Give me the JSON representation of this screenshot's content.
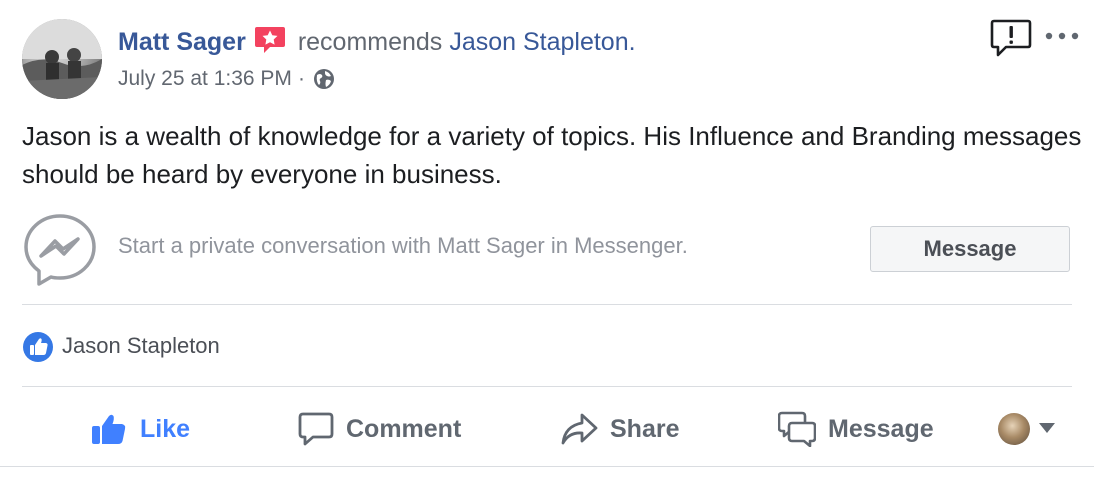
{
  "post": {
    "author": "Matt Sager",
    "recommend_text": "recommends",
    "recommended_page": "Jason Stapleton.",
    "timestamp": "July 25 at 1:36 PM",
    "separator": "·",
    "audience_icon": "globe-icon",
    "body": "Jason is a wealth of knowledge for a variety of topics. His Influence and Branding messages should be heard by everyone in business."
  },
  "messenger_prompt": {
    "text": "Start a private conversation with Matt Sager in Messenger.",
    "button_label": "Message"
  },
  "reactions": {
    "icon": "thumbs-up-icon",
    "names": "Jason Stapleton"
  },
  "actions": [
    {
      "label": "Like",
      "icon": "thumbs-up-icon"
    },
    {
      "label": "Comment",
      "icon": "comment-icon"
    },
    {
      "label": "Share",
      "icon": "share-icon"
    },
    {
      "label": "Message",
      "icon": "messenger-icon"
    }
  ],
  "colors": {
    "link": "#385898",
    "like_active": "#4080ff",
    "secondary_text": "#616770",
    "recommend_badge": "#f3425f"
  }
}
